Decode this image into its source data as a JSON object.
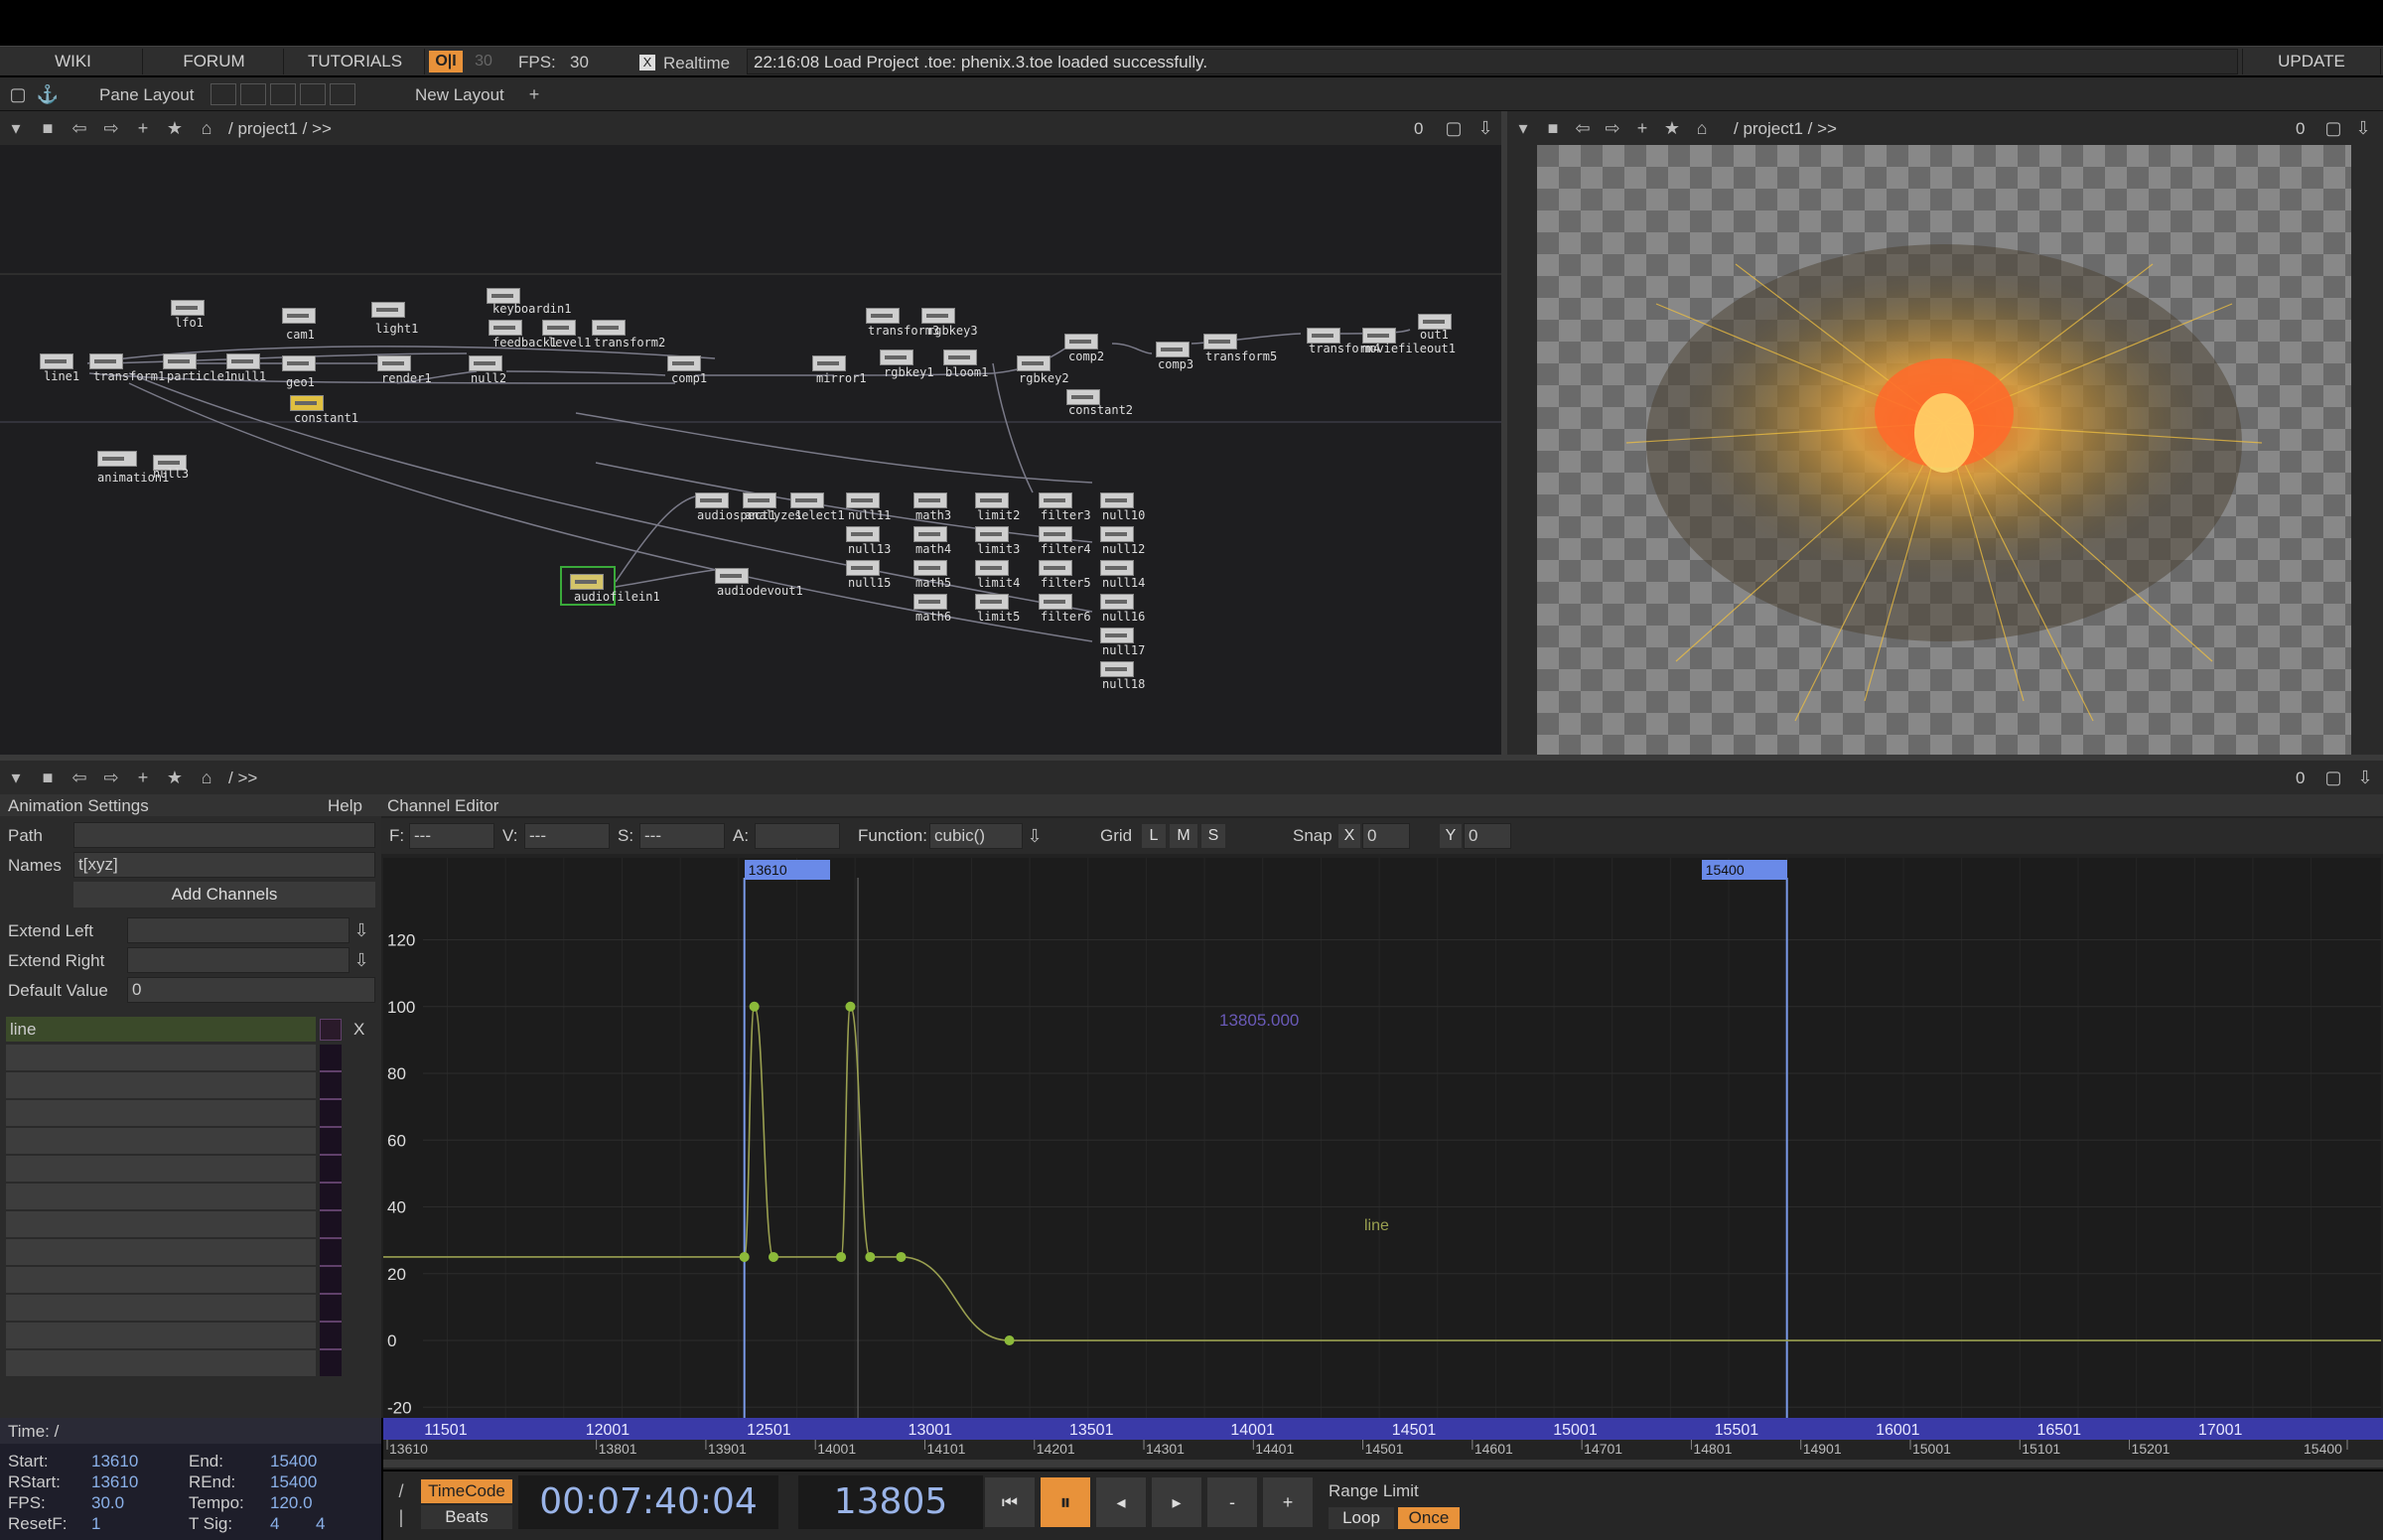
{
  "menu": {
    "wiki": "WIKI",
    "forum": "FORUM",
    "tutorials": "TUTORIALS",
    "oi": "O|I",
    "fps_target": "30",
    "fps_label": "FPS:",
    "fps_value": "30",
    "realtime_check": "X",
    "realtime": "Realtime",
    "status": "22:16:08 Load Project .toe: phenix.3.toe loaded successfully.",
    "update": "UPDATE"
  },
  "layout_bar": {
    "pane_layout": "Pane Layout",
    "new_layout": "New Layout"
  },
  "network_pane": {
    "path": "/ project1 / >>",
    "counter": "0"
  },
  "viewer_pane": {
    "path": "/ project1 / >>",
    "counter": "0"
  },
  "bottom_pane": {
    "path": "/ >>",
    "counter": "0"
  },
  "nodes": [
    {
      "label": "lfo1"
    },
    {
      "label": "cam1"
    },
    {
      "label": "light1"
    },
    {
      "label": "keyboardin1"
    },
    {
      "label": "line1"
    },
    {
      "label": "transform1"
    },
    {
      "label": "particle1"
    },
    {
      "label": "null1"
    },
    {
      "label": "geo1"
    },
    {
      "label": "constant1"
    },
    {
      "label": "render1"
    },
    {
      "label": "null2"
    },
    {
      "label": "feedback1"
    },
    {
      "label": "level1"
    },
    {
      "label": "transform2"
    },
    {
      "label": "comp1"
    },
    {
      "label": "mirror1"
    },
    {
      "label": "transform3"
    },
    {
      "label": "rgbkey3"
    },
    {
      "label": "rgbkey1"
    },
    {
      "label": "bloom1"
    },
    {
      "label": "rgbkey2"
    },
    {
      "label": "comp2"
    },
    {
      "label": "constant2"
    },
    {
      "label": "comp3"
    },
    {
      "label": "transform5"
    },
    {
      "label": "transform4"
    },
    {
      "label": "moviefileout1"
    },
    {
      "label": "out1"
    },
    {
      "label": "animation1"
    },
    {
      "label": "null3"
    },
    {
      "label": "audiofilein1"
    },
    {
      "label": "audiodevout1"
    },
    {
      "label": "audiospect1"
    },
    {
      "label": "analyze1"
    },
    {
      "label": "select1"
    },
    {
      "label": "null11"
    },
    {
      "label": "math3"
    },
    {
      "label": "limit2"
    },
    {
      "label": "filter3"
    },
    {
      "label": "null10"
    },
    {
      "label": "null13"
    },
    {
      "label": "math4"
    },
    {
      "label": "limit3"
    },
    {
      "label": "filter4"
    },
    {
      "label": "null12"
    },
    {
      "label": "null15"
    },
    {
      "label": "math5"
    },
    {
      "label": "limit4"
    },
    {
      "label": "filter5"
    },
    {
      "label": "null14"
    },
    {
      "label": "math6"
    },
    {
      "label": "limit5"
    },
    {
      "label": "filter6"
    },
    {
      "label": "null16"
    },
    {
      "label": "null17"
    },
    {
      "label": "null18"
    }
  ],
  "anim_settings": {
    "title": "Animation Settings",
    "help": "Help",
    "path_label": "Path",
    "path_value": "",
    "names_label": "Names",
    "names_value": "t[xyz]",
    "add_channels": "Add Channels",
    "extend_left_label": "Extend Left",
    "extend_right_label": "Extend Right",
    "default_value_label": "Default Value",
    "default_value": "0",
    "channels": [
      {
        "name": "line",
        "remove": "X"
      }
    ]
  },
  "channel_editor": {
    "title": "Channel Editor",
    "f_label": "F:",
    "f_value": "---",
    "v_label": "V:",
    "v_value": "---",
    "s_label": "S:",
    "s_value": "---",
    "a_label": "A:",
    "a_value": "",
    "function_label": "Function:",
    "function_value": "cubic()",
    "grid_label": "Grid",
    "grid_l": "L",
    "grid_m": "M",
    "grid_s": "S",
    "snap_label": "Snap",
    "snap_x": "X",
    "snap_x_value": "0",
    "snap_y": "Y",
    "snap_y_value": "0",
    "marker_start": "13610",
    "marker_end": "15400",
    "cursor_readout": "13805.000",
    "channel_label": "line",
    "y_ticks": [
      "120",
      "100",
      "80",
      "60",
      "40",
      "20",
      "0",
      "-20"
    ],
    "x_ruler": [
      "11501",
      "12001",
      "12501",
      "13001",
      "13501",
      "14001",
      "14501",
      "15001",
      "15501",
      "16001",
      "16501",
      "17001"
    ],
    "x_ruler_fine": [
      "13610",
      "13801",
      "13901",
      "14001",
      "14101",
      "14201",
      "14301",
      "14401",
      "14501",
      "14601",
      "14701",
      "14801",
      "14901",
      "15001",
      "15101",
      "15201",
      "15400"
    ]
  },
  "chart_data": {
    "type": "line",
    "series": [
      {
        "name": "line",
        "x": [
          13610,
          13627,
          13660,
          13776,
          13792,
          13826,
          13879,
          14065
        ],
        "y": [
          25,
          100,
          25,
          25,
          100,
          25,
          25,
          0
        ]
      }
    ],
    "xlim": [
      13610,
      15400
    ],
    "ylim": [
      -20,
      120
    ],
    "cursor_x": 13805
  },
  "time": {
    "header": "Time: /",
    "start_label": "Start:",
    "start": "13610",
    "end_label": "End:",
    "end": "15400",
    "rstart_label": "RStart:",
    "rstart": "13610",
    "rend_label": "REnd:",
    "rend": "15400",
    "fps_label": "FPS:",
    "fps": "30.0",
    "tempo_label": "Tempo:",
    "tempo": "120.0",
    "resetf_label": "ResetF:",
    "resetf": "1",
    "tsig_label": "T Sig:",
    "tsig_a": "4",
    "tsig_b": "4"
  },
  "transport": {
    "timecode": "TimeCode",
    "beats": "Beats",
    "clock": "00:07:40:04",
    "frame": "13805",
    "range_limit": "Range Limit",
    "loop": "Loop",
    "once": "Once",
    "minus": "-",
    "plus": "+"
  },
  "colors": {
    "accent_orange": "#e8923a",
    "selection_blue": "#4a4adc",
    "curve": "#9aa050",
    "key": "#8cba3a"
  }
}
